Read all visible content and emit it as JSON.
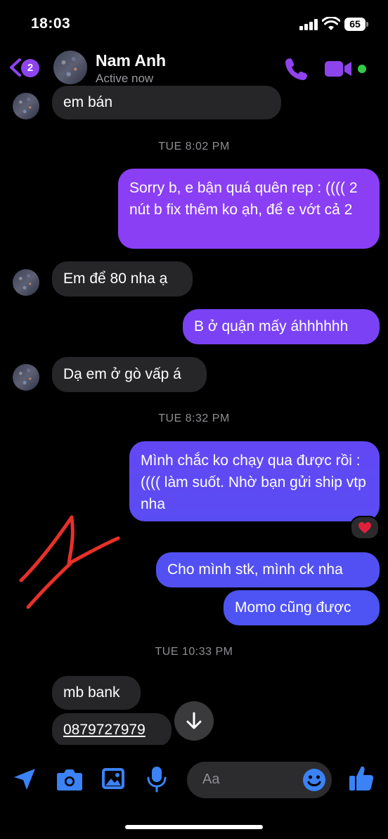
{
  "status_bar": {
    "time": "18:03",
    "battery": "65"
  },
  "header": {
    "unread_badge": "2",
    "contact_name": "Nam Anh",
    "contact_status": "Active now"
  },
  "messages": [
    {
      "side": "in",
      "text": "em bán"
    },
    {
      "timestamp": "TUE 8:02 PM"
    },
    {
      "side": "out",
      "text": "Sorry b, e bận quá quên rep : (((( 2 nút b fix thêm ko ạh, để e vớt cả 2"
    },
    {
      "side": "in",
      "text": "Em để 80 nha ạ"
    },
    {
      "side": "out",
      "text": "B ở quận mấy áhhhhhh"
    },
    {
      "side": "in",
      "text": "Dạ em ở gò vấp á"
    },
    {
      "timestamp": "TUE 8:32 PM"
    },
    {
      "side": "out",
      "text": "Mình chắc ko chạy qua được rồi :(((( làm suốt. Nhờ bạn gửi ship vtp nha",
      "reaction": "heart"
    },
    {
      "side": "out",
      "text": "Cho mình stk, mình ck nha"
    },
    {
      "side": "out",
      "text": "Momo cũng được"
    },
    {
      "timestamp": "TUE 10:33 PM"
    },
    {
      "side": "in",
      "text": "mb bank"
    },
    {
      "side": "in",
      "text": "0879727979",
      "link": true
    }
  ],
  "composer": {
    "placeholder": "Aa"
  },
  "colors": {
    "accent": "#8e44ec",
    "incoming_bubble": "#262629",
    "outgoing_top": "#8a3ff5",
    "outgoing_bottom": "#4e53f3",
    "online": "#31cc46",
    "annotation_stroke": "#e8302a"
  },
  "icons": [
    "back-chevron-icon",
    "phone-icon",
    "video-camera-icon",
    "location-arrow-icon",
    "camera-icon",
    "gallery-icon",
    "microphone-icon",
    "emoji-icon",
    "thumbs-up-icon",
    "scroll-down-arrow-icon"
  ]
}
